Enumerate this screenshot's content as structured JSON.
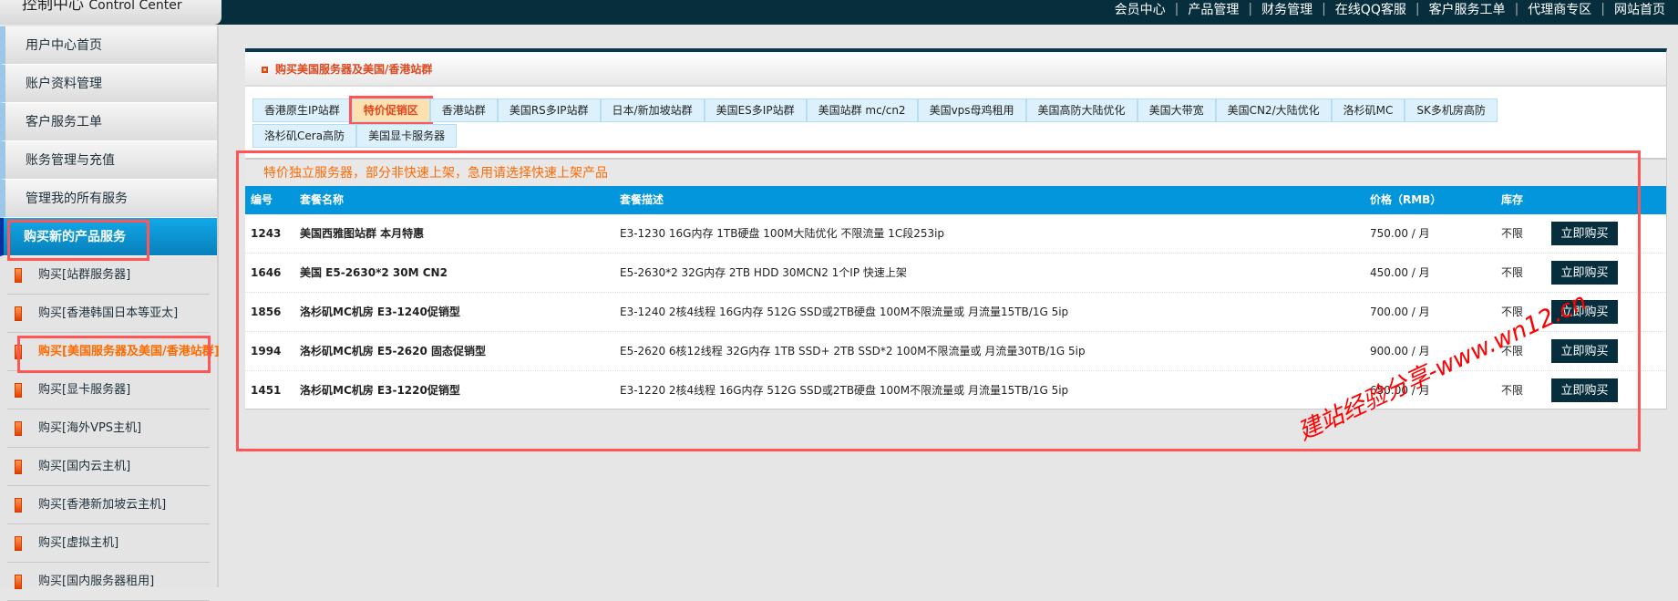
{
  "header": {
    "logo": "控制中心",
    "logo_en": "Control Center",
    "nav": [
      "会员中心",
      "产品管理",
      "财务管理",
      "在线QQ客服",
      "客户服务工单",
      "代理商专区",
      "网站首页"
    ]
  },
  "sidebar": {
    "menu": [
      "用户中心首页",
      "账户资料管理",
      "客户服务工单",
      "账务管理与充值",
      "管理我的所有服务",
      "购买新的产品服务"
    ],
    "active_menu": "购买新的产品服务",
    "subitems": [
      "购买[站群服务器]",
      "购买[香港韩国日本等亚太]",
      "购买[美国服务器及美国/香港站群]",
      "购买[显卡服务器]",
      "购买[海外VPS主机]",
      "购买[国内云主机]",
      "购买[香港新加坡云主机]",
      "购买[虚拟主机]",
      "购买[国内服务器租用]"
    ],
    "current_subitem": "购买[美国服务器及美国/香港站群]"
  },
  "panel": {
    "title": "购买美国服务器及美国/香港站群",
    "tabs": [
      "香港原生IP站群",
      "特价促销区",
      "香港站群",
      "美国RS多IP站群",
      "日本/新加坡站群",
      "美国ES多IP站群",
      "美国站群 mc/cn2",
      "美国vps母鸡租用",
      "美国高防大陆优化",
      "美国大带宽",
      "美国CN2/大陆优化",
      "洛杉矶MC",
      "SK多机房高防",
      "洛杉矶Cera高防",
      "美国显卡服务器"
    ],
    "active_tab": "特价促销区",
    "notice": "特价独立服务器，部分非快速上架，急用请选择快速上架产品",
    "columns": [
      "编号",
      "套餐名称",
      "套餐描述",
      "价格（RMB）",
      "库存"
    ],
    "rows": [
      {
        "id": "1243",
        "name": "美国西雅图站群 本月特惠",
        "desc": "E3-1230 16G内存 1TB硬盘 100M大陆优化 不限流量 1C段253ip",
        "price": "750.00 / 月",
        "stock": "不限",
        "buy": "立即购买"
      },
      {
        "id": "1646",
        "name": "美国 E5-2630*2 30M CN2",
        "desc": "E5-2630*2 32G内存 2TB HDD 30MCN2 1个IP 快速上架",
        "price": "450.00 / 月",
        "stock": "不限",
        "buy": "立即购买"
      },
      {
        "id": "1856",
        "name": "洛杉矶MC机房 E3-1240促销型",
        "desc": "E3-1240 2核4线程 16G内存 512G SSD或2TB硬盘 100M不限流量或 月流量15TB/1G 5ip",
        "price": "700.00 / 月",
        "stock": "不限",
        "buy": "立即购买"
      },
      {
        "id": "1994",
        "name": "洛杉矶MC机房 E5-2620 固态促销型",
        "desc": "E5-2620 6核12线程 32G内存 1TB SSD+ 2TB SSD*2 100M不限流量或 月流量30TB/1G 5ip",
        "price": "900.00 / 月",
        "stock": "不限",
        "buy": "立即购买"
      },
      {
        "id": "1451",
        "name": "洛杉矶MC机房 E3-1220促销型",
        "desc": "E3-1220 2核4线程 16G内存 512G SSD或2TB硬盘 100M不限流量或 月流量15TB/1G 5ip",
        "price": "650.00 / 月",
        "stock": "不限",
        "buy": "立即购买"
      }
    ]
  },
  "watermark": "建站经验分享-www.wn12.cn",
  "colors": {
    "topbar": "#062e3d",
    "accent": "#0396dc",
    "highlight": "#ff6a00",
    "annotation": "#ff5555"
  }
}
